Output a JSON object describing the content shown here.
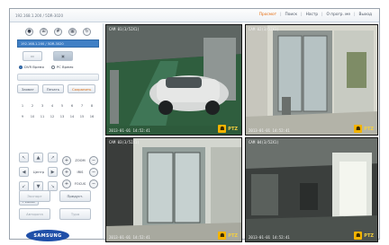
{
  "header": {
    "address": "192.168.1.200 / 5DR-3020",
    "nav": [
      "Просмот",
      "Поиск",
      "Настр",
      "О прогр. ме",
      "Выход"
    ]
  },
  "left_panel": {
    "top_icons": [
      "grid-1-icon",
      "grid-4-icon",
      "grid-9-icon",
      "grid-16-icon",
      "sequence-icon"
    ],
    "address_box": "192.168.1.200 / 5DR-3020",
    "radio_1": "DVR Время",
    "radio_2": "PC Время",
    "actions": [
      "Захват",
      "Печать",
      "Сохранить"
    ],
    "numbers_row1": [
      "1",
      "2",
      "3",
      "4",
      "5",
      "6",
      "7",
      "8"
    ],
    "numbers_row2": [
      "9",
      "10",
      "11",
      "12",
      "13",
      "14",
      "15",
      "16"
    ],
    "dpad_center": "Центр",
    "ptz_labels": [
      "ZOOM",
      "IRIS",
      "FOCUS"
    ],
    "reset": "Режим",
    "bottom_left_1": "Экспорт",
    "bottom_right_1": "Предуст.",
    "bottom_left_2": "Авторота",
    "bottom_right_2": "Тура",
    "logo": "SAMSUNG"
  },
  "cameras": [
    {
      "label": "CAM 01(3/52X1)",
      "timestamp": "2013-01-01 14:52:41",
      "ptz": "PTZ"
    },
    {
      "label": "CAM 02(3/52X1)",
      "timestamp": "2013-01-01 14:52:41",
      "ptz": "PTZ"
    },
    {
      "label": "CAM 03(3/52X1)",
      "timestamp": "2013-01-01 14:52:41",
      "ptz": "PTZ"
    },
    {
      "label": "CAM 04(3/52X1)",
      "timestamp": "2013-01-01 14:52:41",
      "ptz": "PTZ"
    }
  ],
  "colors": {
    "accent": "#3f7fc5",
    "nav_active": "#e56a0c",
    "ptz_badge": "#f4b400",
    "logo": "#1f4fa8"
  }
}
